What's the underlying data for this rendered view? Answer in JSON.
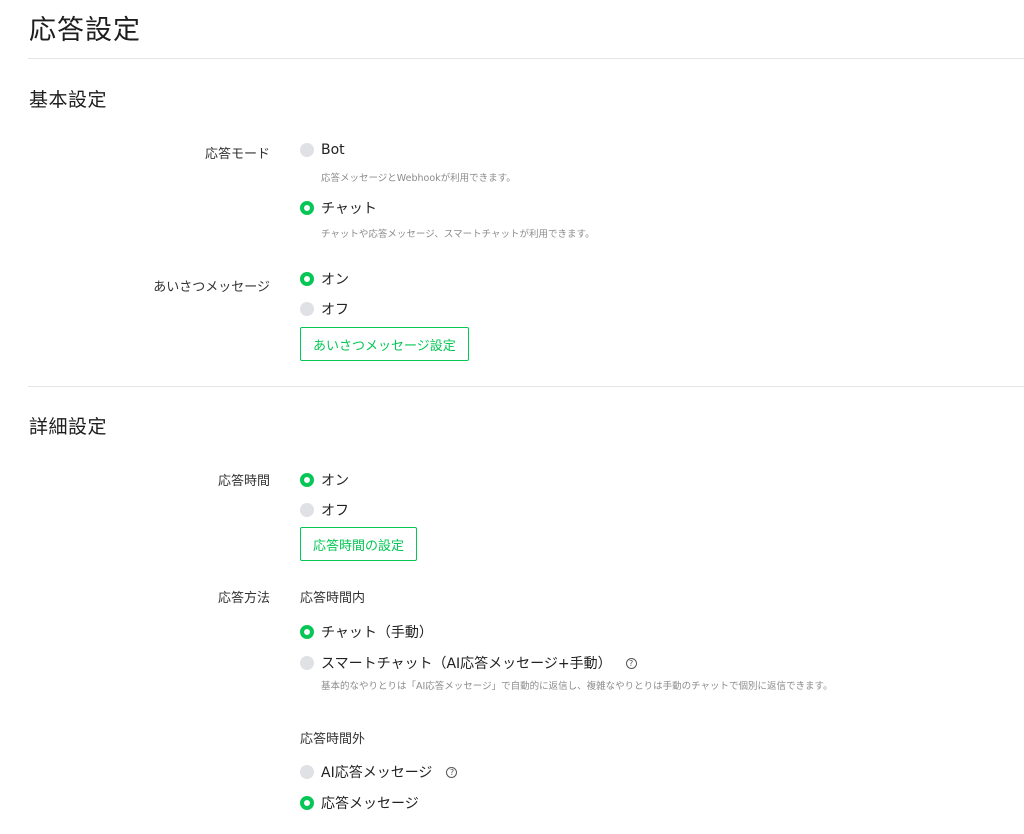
{
  "page_title": "応答設定",
  "basic": {
    "title": "基本設定",
    "response_mode": {
      "label": "応答モード",
      "bot_label": "Bot",
      "bot_desc": "応答メッセージとWebhookが利用できます。",
      "chat_label": "チャット",
      "chat_desc": "チャットや応答メッセージ、スマートチャットが利用できます。",
      "selected": "chat"
    },
    "greeting": {
      "label": "あいさつメッセージ",
      "on_label": "オン",
      "off_label": "オフ",
      "selected": "on",
      "button_label": "あいさつメッセージ設定"
    }
  },
  "detail": {
    "title": "詳細設定",
    "response_hours": {
      "label": "応答時間",
      "on_label": "オン",
      "off_label": "オフ",
      "selected": "on",
      "button_label": "応答時間の設定"
    },
    "response_method": {
      "label": "応答方法",
      "within_hours": {
        "title": "応答時間内",
        "manual_label": "チャット（手動）",
        "smart_label": "スマートチャット（AI応答メッセージ+手動）",
        "smart_desc": "基本的なやりとりは「AI応答メッセージ」で自動的に返信し、複雑なやりとりは手動のチャットで個別に返信できます。",
        "selected": "manual"
      },
      "outside_hours": {
        "title": "応答時間外",
        "ai_label": "AI応答メッセージ",
        "auto_label": "応答メッセージ",
        "selected": "auto"
      }
    }
  },
  "help_icon_text": "?",
  "colors": {
    "accent": "#06c755",
    "radio_off": "#dfe1e5"
  }
}
